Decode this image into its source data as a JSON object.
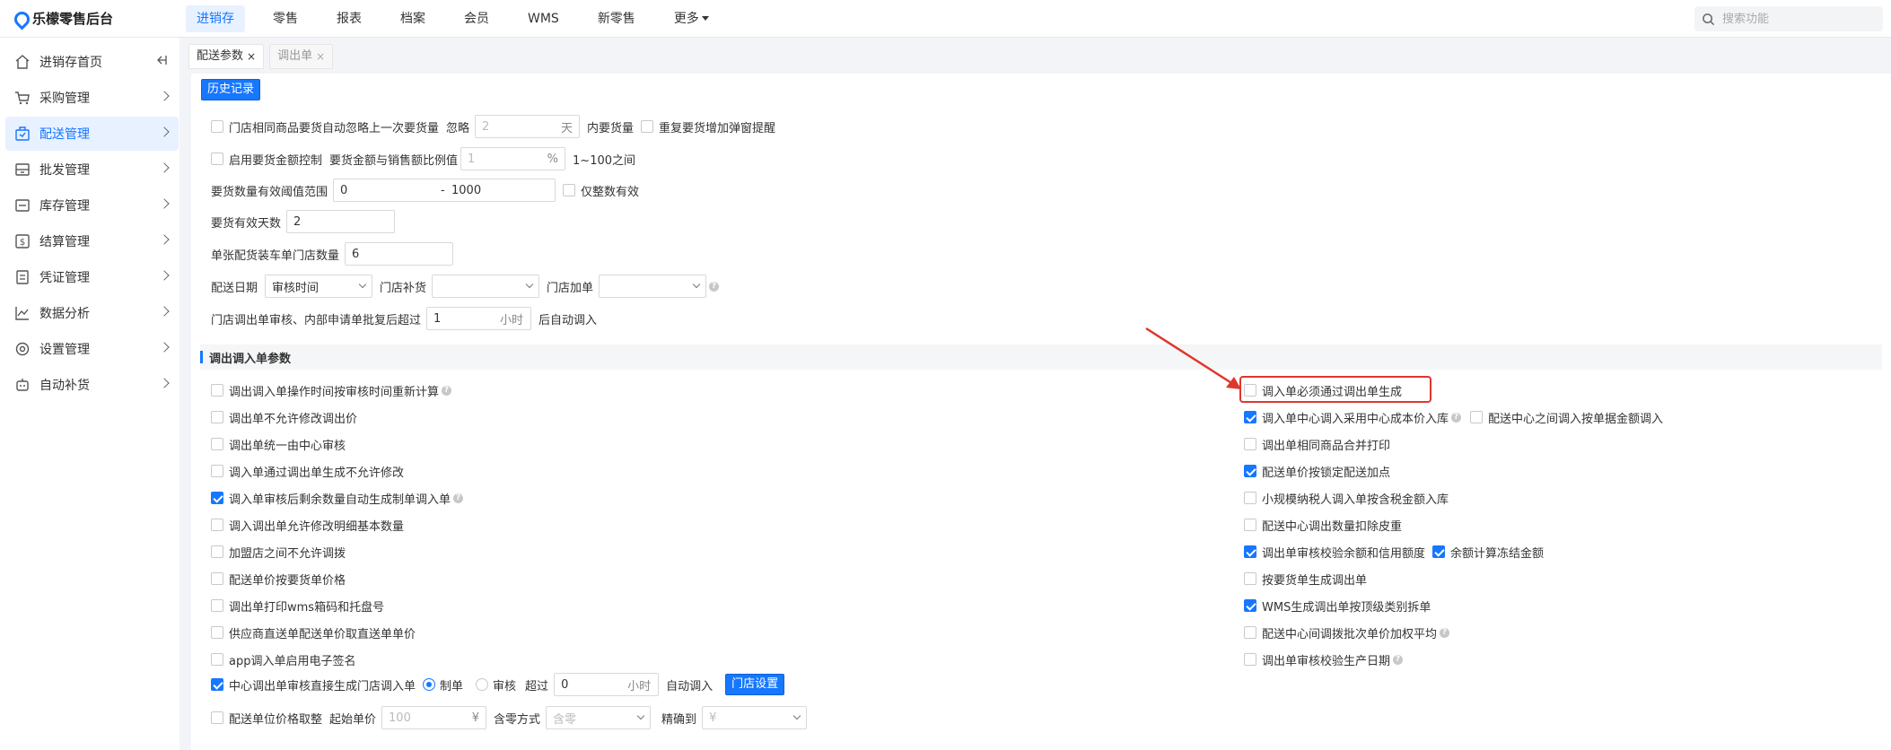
{
  "app": {
    "title": "乐檬零售后台"
  },
  "nav": {
    "items": [
      "进销存",
      "零售",
      "报表",
      "档案",
      "会员",
      "WMS",
      "新零售",
      "更多"
    ]
  },
  "search": {
    "placeholder": "搜索功能"
  },
  "sidebar": {
    "items": [
      {
        "label": "进销存首页"
      },
      {
        "label": "采购管理"
      },
      {
        "label": "配送管理"
      },
      {
        "label": "批发管理"
      },
      {
        "label": "库存管理"
      },
      {
        "label": "结算管理"
      },
      {
        "label": "凭证管理"
      },
      {
        "label": "数据分析"
      },
      {
        "label": "设置管理"
      },
      {
        "label": "自动补货"
      }
    ]
  },
  "tabs": [
    {
      "label": "配送参数",
      "close": "×"
    },
    {
      "label": "调出单",
      "close": "×"
    }
  ],
  "history_btn": "历史记录",
  "form": {
    "r1": {
      "label": "门店相同商品要货自动忽略上一次要货量",
      "ignore": "忽略",
      "value_placeholder": "2",
      "unit": "天",
      "suffix": "内要货量",
      "cb2": "重复要货增加弹窗提醒"
    },
    "r2": {
      "label": "启用要货金额控制",
      "mid": "要货金额与销售额比例值",
      "value_placeholder": "1",
      "unit": "%",
      "suffix": "1~100之间"
    },
    "r3": {
      "label": "要货数量有效阈值范围",
      "min": "0",
      "sep": "-",
      "max": "1000",
      "cb": "仅整数有效"
    },
    "r4": {
      "label": "要货有效天数",
      "value": "2"
    },
    "r5": {
      "label": "单张配货装车单门店数量",
      "value": "6"
    },
    "r6": {
      "label": "配送日期",
      "date_sel": "审核时间",
      "replenish": "门店补货",
      "add": "门店加单"
    },
    "r7": {
      "label": "门店调出单审核、内部申请单批复后超过",
      "value": "1",
      "unit": "小时",
      "suffix": "后自动调入"
    }
  },
  "section_title": "调出调入单参数",
  "left_opts": [
    "调出调入单操作时间按审核时间重新计算",
    "调出单不允许修改调出价",
    "调出单统一由中心审核",
    "调入单通过调出单生成不允许修改",
    "调入单审核后剩余数量自动生成制单调入单",
    "调入调出单允许修改明细基本数量",
    "加盟店之间不允许调拨",
    "配送单价按要货单价格",
    "调出单打印wms箱码和托盘号",
    "供应商直送单配送单价取直送单单价",
    "app调入单启用电子签名"
  ],
  "right_opts": [
    "调入单必须通过调出单生成",
    "调入单中心调入采用中心成本价入库",
    "调出单相同商品合并打印",
    "配送单价按锁定配送加点",
    "小规模纳税人调入单按含税金额入库",
    "配送中心调出数量扣除皮重",
    "调出单审核校验余额和信用额度",
    "按要货单生成调出单",
    "WMS生成调出单按顶级类别拆单",
    "配送中心间调拨批次单价加权平均",
    "调出单审核校验生产日期"
  ],
  "right_extra": {
    "center_batch": "配送中心之间调入按单据金额调入",
    "freeze": "余额计算冻结金额"
  },
  "bottom": {
    "r1": {
      "label": "中心调出单审核直接生成门店调入单",
      "radio1": "制单",
      "radio2": "审核",
      "over": "超过",
      "value": "0",
      "unit": "小时",
      "suffix": "自动调入",
      "btn": "门店设置"
    },
    "r2": {
      "label": "配送单位价格取整",
      "start": "起始单价",
      "start_placeholder": "100",
      "unit": "¥",
      "mode": "含零方式",
      "mode_placeholder": "含零",
      "precise": "精确到",
      "precise_placeholder": "¥"
    }
  }
}
